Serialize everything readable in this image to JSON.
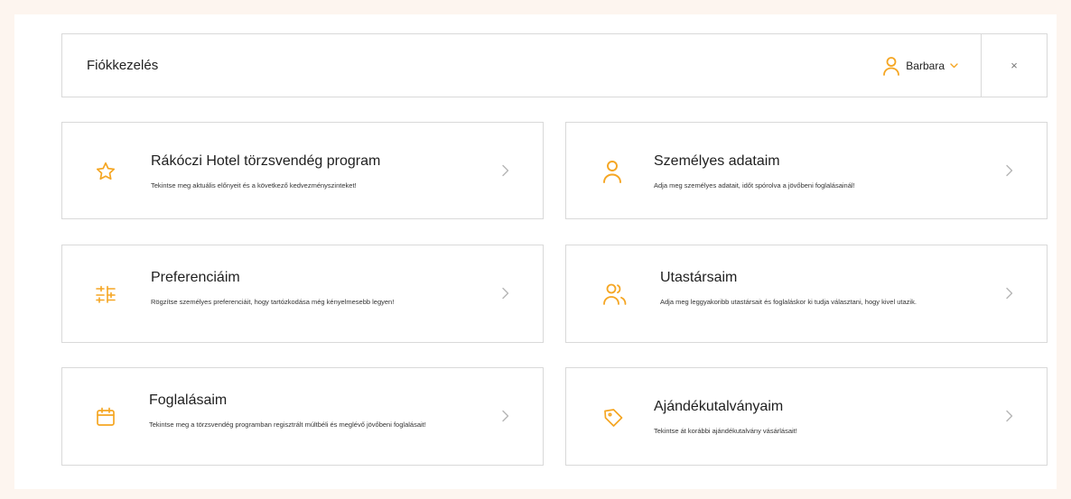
{
  "header": {
    "title": "Fiókkezelés",
    "user_name": "Barbara",
    "close_label": "×"
  },
  "colors": {
    "accent": "#f5a623",
    "border": "#d9d9d9",
    "background": "#fdf5ef",
    "chevron": "#b5b5b5"
  },
  "cards": [
    {
      "icon": "star-icon",
      "title": "Rákóczi Hotel törzsvendég program",
      "description": "Tekintse meg aktuális előnyeit és a következő kedvezményszinteket!"
    },
    {
      "icon": "user-icon",
      "title": "Személyes adataim",
      "description": "Adja meg személyes adatait, időt spórolva a jövőbeni foglalásainál!"
    },
    {
      "icon": "sliders-icon",
      "title": "Preferenciáim",
      "description": "Rögzítse személyes preferenciáit, hogy tartózkodása még kényelmesebb legyen!"
    },
    {
      "icon": "users-icon",
      "title": "Utastársaim",
      "description": "Adja meg leggyakoribb utastársait és foglaláskor ki tudja választani, hogy kivel utazik."
    },
    {
      "icon": "calendar-icon",
      "title": "Foglalásaim",
      "description": "Tekintse meg a törzsvendég programban regisztrált múltbéli és meglévő jövőbeni foglalásait!"
    },
    {
      "icon": "tag-icon",
      "title": "Ajándékutalványaim",
      "description": "Tekintse át korábbi ajándékutalvány vásárlásait!"
    }
  ]
}
